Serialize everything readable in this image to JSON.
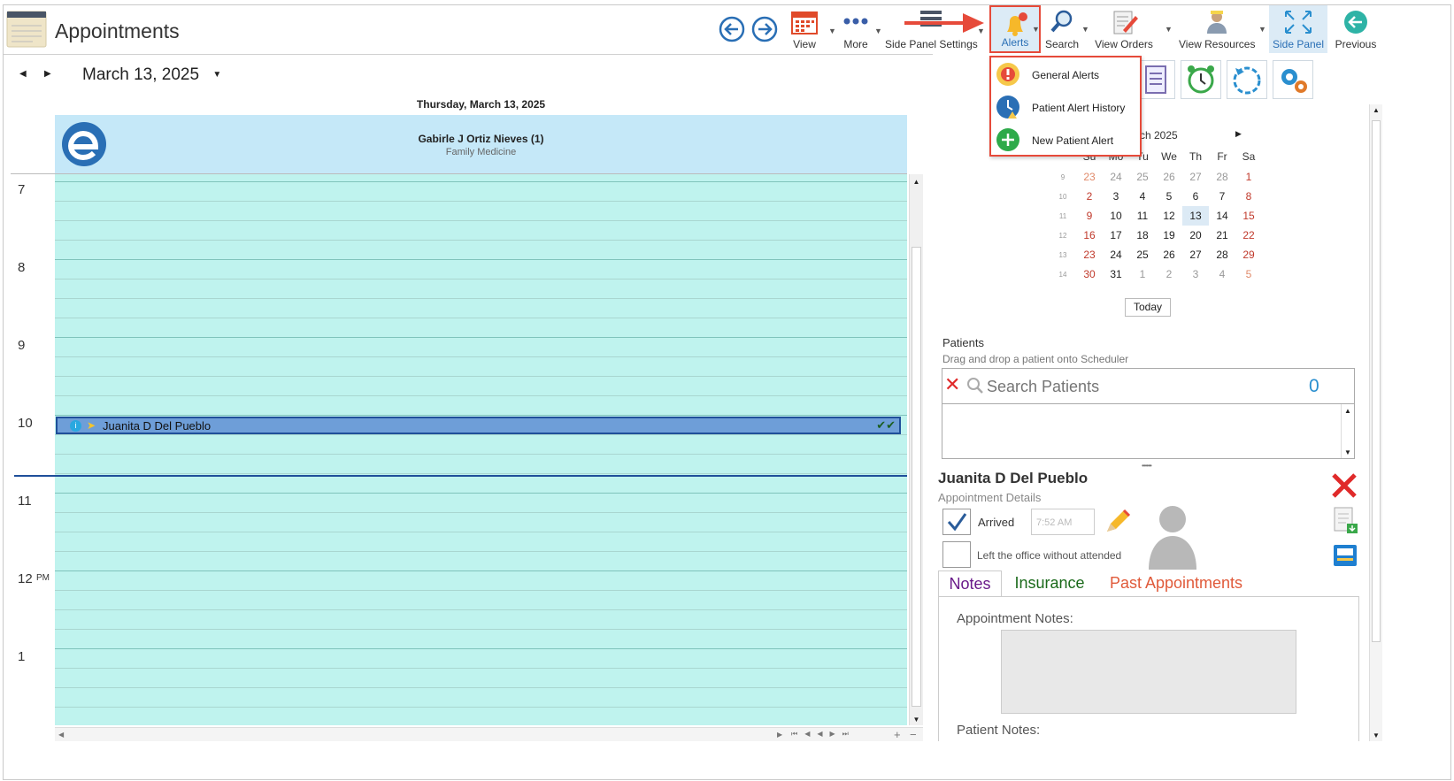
{
  "app": {
    "title": "Appointments"
  },
  "toolbar": {
    "view": "View",
    "more": "More",
    "side_panel_settings": "Side Panel Settings",
    "alerts": "Alerts",
    "search": "Search",
    "view_orders": "View Orders",
    "view_resources": "View Resources",
    "side_panel": "Side Panel",
    "previous": "Previous"
  },
  "alerts_menu": {
    "items": [
      "General Alerts",
      "Patient Alert History",
      "New Patient Alert"
    ]
  },
  "scheduler": {
    "date": "March 13, 2025",
    "day_header": "Thursday, March 13, 2025",
    "provider_name": "Gabirle J Ortiz Nieves (1)",
    "provider_specialty": "Family Medicine",
    "hours": [
      "7",
      "8",
      "9",
      "10",
      "11",
      "12",
      "1"
    ],
    "pm_label": "PM",
    "appointment": {
      "patient": "Juanita D Del Pueblo",
      "checks": "✔✔"
    }
  },
  "mini_calendar": {
    "month_label": "ch 2025",
    "headers": [
      "Su",
      "Mo",
      "Tu",
      "We",
      "Th",
      "Fr",
      "Sa"
    ],
    "weeks": [
      {
        "wk": "9",
        "days": [
          "23",
          "24",
          "25",
          "26",
          "27",
          "28",
          "1"
        ]
      },
      {
        "wk": "10",
        "days": [
          "2",
          "3",
          "4",
          "5",
          "6",
          "7",
          "8"
        ]
      },
      {
        "wk": "11",
        "days": [
          "9",
          "10",
          "11",
          "12",
          "13",
          "14",
          "15"
        ]
      },
      {
        "wk": "12",
        "days": [
          "16",
          "17",
          "18",
          "19",
          "20",
          "21",
          "22"
        ]
      },
      {
        "wk": "13",
        "days": [
          "23",
          "24",
          "25",
          "26",
          "27",
          "28",
          "29"
        ]
      },
      {
        "wk": "14",
        "days": [
          "30",
          "31",
          "1",
          "2",
          "3",
          "4",
          "5"
        ]
      }
    ],
    "today_button": "Today"
  },
  "patients": {
    "title": "Patients",
    "subtitle": "Drag and drop a patient onto Scheduler",
    "search_placeholder": "Search Patients",
    "count": "0"
  },
  "details": {
    "patient_name": "Juanita D Del Pueblo",
    "subtitle": "Appointment Details",
    "arrived_label": "Arrived",
    "arrived_time": "7:52 AM",
    "left_label": "Left the office without attended",
    "tabs": [
      "Notes",
      "Insurance",
      "Past Appointments"
    ],
    "appointment_notes_label": "Appointment Notes:",
    "patient_notes_label": "Patient Notes:"
  },
  "colors": {
    "accent": "#2a6fb5",
    "grid_bg": "#bff3ee",
    "header_bg": "#c5e8f8",
    "highlight": "#e64a3a"
  }
}
